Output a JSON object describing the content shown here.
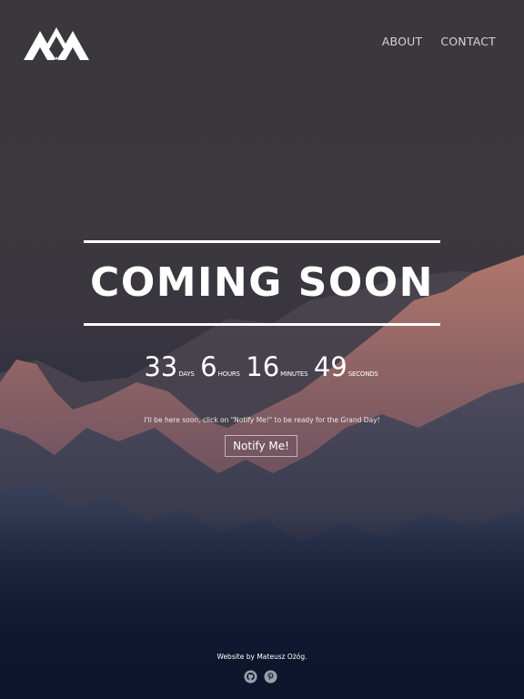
{
  "header": {
    "logo_icon": "mountain-logo-icon",
    "nav": [
      {
        "label": "ABOUT"
      },
      {
        "label": "CONTACT"
      }
    ]
  },
  "hero": {
    "title": "COMING SOON"
  },
  "countdown": {
    "days": {
      "value": "33",
      "unit": "DAYS"
    },
    "hours": {
      "value": "6",
      "unit": "HOURS"
    },
    "minutes": {
      "value": "16",
      "unit": "MINUTES"
    },
    "seconds": {
      "value": "49",
      "unit": "SECONDS"
    }
  },
  "notice": "I'll be here soon, click on \"Notify Me!\" to be ready for the Grand Day!",
  "notify_button": "Notify Me!",
  "footer": {
    "credit": "Website by Mateusz Ożóg.",
    "icons": [
      "github-icon",
      "pinterest-icon"
    ]
  },
  "colors": {
    "text": "#ffffff",
    "nav_text": "#d6d3d6",
    "sky": "#3a383c",
    "mountain_glow": "#a86a5e",
    "bottom": "#0f1830"
  }
}
